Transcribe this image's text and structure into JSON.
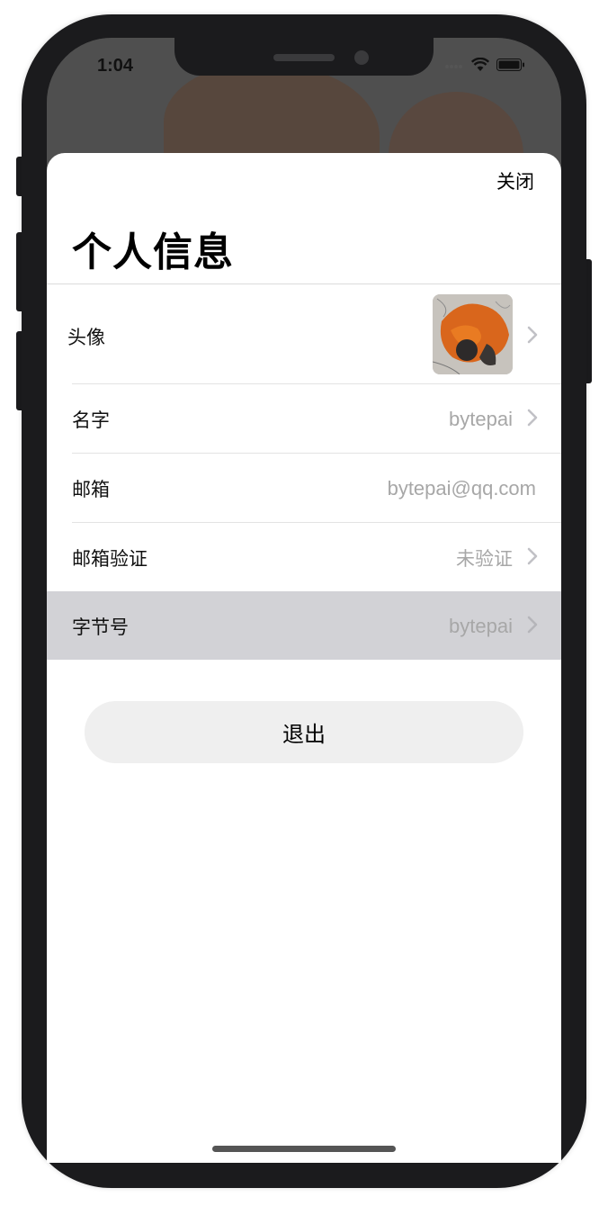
{
  "status_bar": {
    "time": "1:04"
  },
  "sheet": {
    "close_label": "关闭",
    "title": "个人信息"
  },
  "rows": [
    {
      "label": "头像",
      "value": ""
    },
    {
      "label": "名字",
      "value": "bytepai"
    },
    {
      "label": "邮箱",
      "value": "bytepai@qq.com"
    },
    {
      "label": "邮箱验证",
      "value": "未验证"
    },
    {
      "label": "字节号",
      "value": "bytepai"
    }
  ],
  "logout_label": "退出",
  "colors": {
    "selected_row": "#d2d2d6",
    "secondary_text": "#a7a7a7",
    "button_bg": "#efefef"
  },
  "icons": [
    "wifi-icon",
    "battery-icon",
    "signal-icon",
    "chevron-right-icon"
  ]
}
